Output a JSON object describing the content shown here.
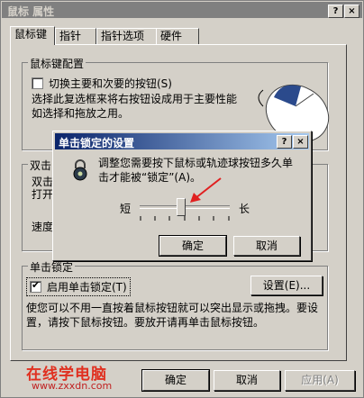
{
  "window": {
    "title": "鼠标 属性",
    "help": "?",
    "close": "×"
  },
  "tabs": [
    "鼠标键",
    "指针",
    "指针选项",
    "硬件"
  ],
  "button_config": {
    "group_label": "鼠标键配置",
    "switch_label": "切换主要和次要的按钮(S)",
    "desc_line1": "选择此复选框来将右按钮设成用于主要性能",
    "desc_line2": "如选择和拖放之用。"
  },
  "double_click": {
    "group_label": "双击",
    "line1": "双击",
    "line2": "打开",
    "speed_label": "速度"
  },
  "clicklock": {
    "group_label": "单击锁定",
    "enable_label": "启用单击锁定(T)",
    "settings_button": "设置(E)...",
    "desc_line1": "使您可以不用一直按着鼠标按钮就可以突出显示或拖拽。要设",
    "desc_line2": "置，请按下鼠标按钮。要放开请再单击鼠标按钮。",
    "checked": true
  },
  "dialog": {
    "title": "单击锁定的设置",
    "help": "?",
    "close": "×",
    "text_line1": "调整您需要按下鼠标或轨迹球按钮多久单",
    "text_line2": "击才能被“锁定”(A)。",
    "short_label": "短",
    "long_label": "长",
    "slider_value": 0.45,
    "ok": "确定",
    "cancel": "取消"
  },
  "footer": {
    "ok": "确定",
    "cancel": "取消",
    "apply": "应用(A)"
  },
  "watermark": {
    "line1": "在线学电脑",
    "line2": "www.zxxdn.com"
  },
  "colors": {
    "title_inactive": "#808080",
    "dialog_title": "#0a246a",
    "face": "#d4d0c8",
    "arrow": "#e02020",
    "watermark": "#e03020"
  }
}
